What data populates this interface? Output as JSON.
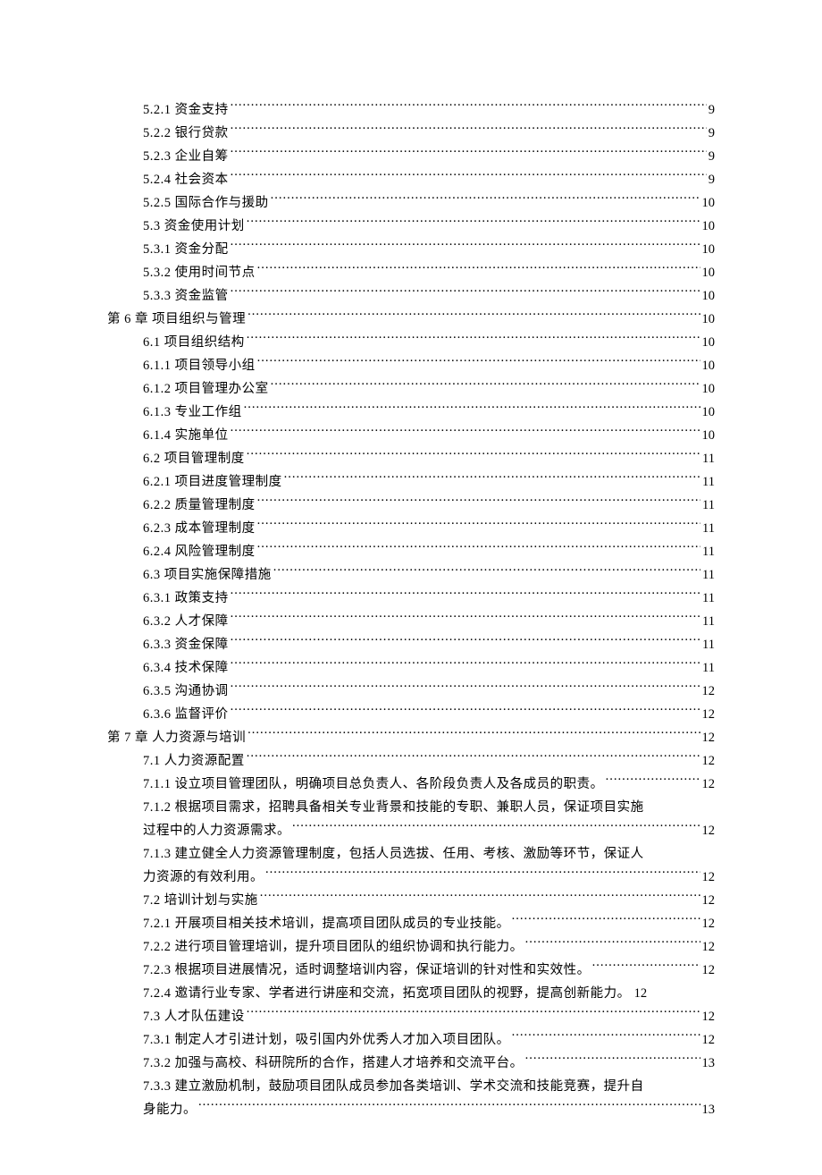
{
  "toc": [
    {
      "level": 2,
      "title": "5.2.1 资金支持",
      "page": "9"
    },
    {
      "level": 2,
      "title": "5.2.2 银行贷款",
      "page": "9"
    },
    {
      "level": 2,
      "title": "5.2.3 企业自筹",
      "page": "9"
    },
    {
      "level": 2,
      "title": "5.2.4 社会资本",
      "page": "9"
    },
    {
      "level": 2,
      "title": "5.2.5 国际合作与援助",
      "page": "10"
    },
    {
      "level": 2,
      "title": "5.3 资金使用计划",
      "page": "10"
    },
    {
      "level": 2,
      "title": "5.3.1 资金分配 ",
      "page": "10"
    },
    {
      "level": 2,
      "title": "5.3.2 使用时间节点",
      "page": "10"
    },
    {
      "level": 2,
      "title": "5.3.3 资金监管 ",
      "page": "10"
    },
    {
      "level": 1,
      "title": "第 6 章 项目组织与管理",
      "page": "10"
    },
    {
      "level": 2,
      "title": "6.1 项目组织结构",
      "page": "10"
    },
    {
      "level": 2,
      "title": "6.1.1 项目领导小组",
      "page": "10"
    },
    {
      "level": 2,
      "title": "6.1.2 项目管理办公室",
      "page": "10"
    },
    {
      "level": 2,
      "title": "6.1.3 专业工作组",
      "page": "10"
    },
    {
      "level": 2,
      "title": "6.1.4 实施单位 ",
      "page": "10"
    },
    {
      "level": 2,
      "title": "6.2 项目管理制度",
      "page": "11"
    },
    {
      "level": 2,
      "title": "6.2.1 项目进度管理制度",
      "page": "11"
    },
    {
      "level": 2,
      "title": "6.2.2 质量管理制度",
      "page": "11"
    },
    {
      "level": 2,
      "title": "6.2.3 成本管理制度",
      "page": "11"
    },
    {
      "level": 2,
      "title": "6.2.4 风险管理制度",
      "page": "11"
    },
    {
      "level": 2,
      "title": "6.3 项目实施保障措施",
      "page": "11"
    },
    {
      "level": 2,
      "title": "6.3.1 政策支持 ",
      "page": "11"
    },
    {
      "level": 2,
      "title": "6.3.2 人才保障 ",
      "page": "11"
    },
    {
      "level": 2,
      "title": "6.3.3 资金保障 ",
      "page": "11"
    },
    {
      "level": 2,
      "title": "6.3.4 技术保障 ",
      "page": "11"
    },
    {
      "level": 2,
      "title": "6.3.5 沟通协调 ",
      "page": "12"
    },
    {
      "level": 2,
      "title": "6.3.6 监督评价 ",
      "page": "12"
    },
    {
      "level": 1,
      "title": "第 7 章 人力资源与培训",
      "page": "12"
    },
    {
      "level": 2,
      "title": "7.1 人力资源配置",
      "page": "12"
    },
    {
      "level": 2,
      "title": "7.1.1 设立项目管理团队，明确项目总负责人、各阶段负责人及各成员的职责。 ",
      "page": "12"
    },
    {
      "level": 2,
      "title_line1": "7.1.2 根据项目需求，招聘具备相关专业背景和技能的专职、兼职人员，保证项目实施",
      "title_line2": "过程中的人力资源需求。 ",
      "page": "12",
      "wrap": true
    },
    {
      "level": 2,
      "title_line1": "7.1.3 建立健全人力资源管理制度，包括人员选拔、任用、考核、激励等环节，保证人",
      "title_line2": "力资源的有效利用。 ",
      "page": "12",
      "wrap": true
    },
    {
      "level": 2,
      "title": "7.2 培训计划与实施",
      "page": "12"
    },
    {
      "level": 2,
      "title": "7.2.1 开展项目相关技术培训，提高项目团队成员的专业技能。 ",
      "page": "12"
    },
    {
      "level": 2,
      "title": "7.2.2 进行项目管理培训，提升项目团队的组织协调和执行能力。 ",
      "page": "12"
    },
    {
      "level": 2,
      "title": "7.2.3 根据项目进展情况，适时调整培训内容，保证培训的针对性和实效性。 ",
      "page": "12"
    },
    {
      "level": 2,
      "title": "7.2.4 邀请行业专家、学者进行讲座和交流，拓宽项目团队的视野，提高创新能力。",
      "page": "12",
      "nodots": true
    },
    {
      "level": 2,
      "title": "7.3 人才队伍建设",
      "page": "12"
    },
    {
      "level": 2,
      "title": "7.3.1 制定人才引进计划，吸引国内外优秀人才加入项目团队。 ",
      "page": "12"
    },
    {
      "level": 2,
      "title": "7.3.2 加强与高校、科研院所的合作，搭建人才培养和交流平台。 ",
      "page": "13"
    },
    {
      "level": 2,
      "title_line1": "7.3.3 建立激励机制，鼓励项目团队成员参加各类培训、学术交流和技能竞赛，提升自",
      "title_line2": "身能力。 ",
      "page": "13",
      "wrap": true
    }
  ]
}
